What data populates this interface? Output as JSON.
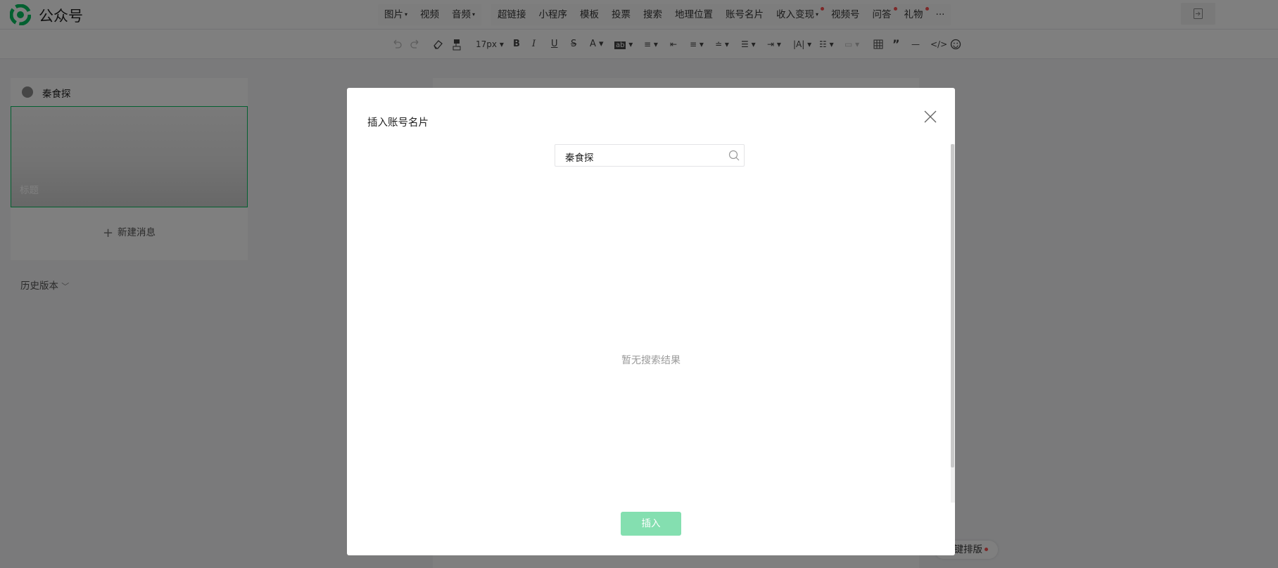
{
  "app": {
    "brand": "公众号",
    "brand_color": "#07c160"
  },
  "topbar": {
    "tools": [
      {
        "label": "图片",
        "dropdown": true,
        "badge": false
      },
      {
        "label": "视频",
        "dropdown": false,
        "badge": false
      },
      {
        "label": "音频",
        "dropdown": true,
        "badge": false
      },
      {
        "label": "超链接",
        "dropdown": false,
        "badge": false
      },
      {
        "label": "小程序",
        "dropdown": false,
        "badge": false
      },
      {
        "label": "模板",
        "dropdown": false,
        "badge": false
      },
      {
        "label": "投票",
        "dropdown": false,
        "badge": false
      },
      {
        "label": "搜索",
        "dropdown": false,
        "badge": false
      },
      {
        "label": "地理位置",
        "dropdown": false,
        "badge": false
      },
      {
        "label": "账号名片",
        "dropdown": false,
        "badge": false
      },
      {
        "label": "收入变现",
        "dropdown": true,
        "badge": true
      },
      {
        "label": "视频号",
        "dropdown": false,
        "badge": false
      },
      {
        "label": "问答",
        "dropdown": false,
        "badge": true
      },
      {
        "label": "礼物",
        "dropdown": false,
        "badge": true
      },
      {
        "label": "···",
        "dropdown": false,
        "badge": false
      }
    ],
    "badge_color": "#fa5151"
  },
  "format_toolbar": {
    "font_size": "17px"
  },
  "sidebar": {
    "account_name": "秦食探",
    "article_title_placeholder": "标题",
    "new_message": "新建消息",
    "history_label": "历史版本"
  },
  "editor": {
    "auto_format": "一键排版"
  },
  "modal": {
    "title": "插入账号名片",
    "search_value": "秦食探",
    "empty_text": "暂无搜索结果",
    "insert_label": "插入"
  }
}
